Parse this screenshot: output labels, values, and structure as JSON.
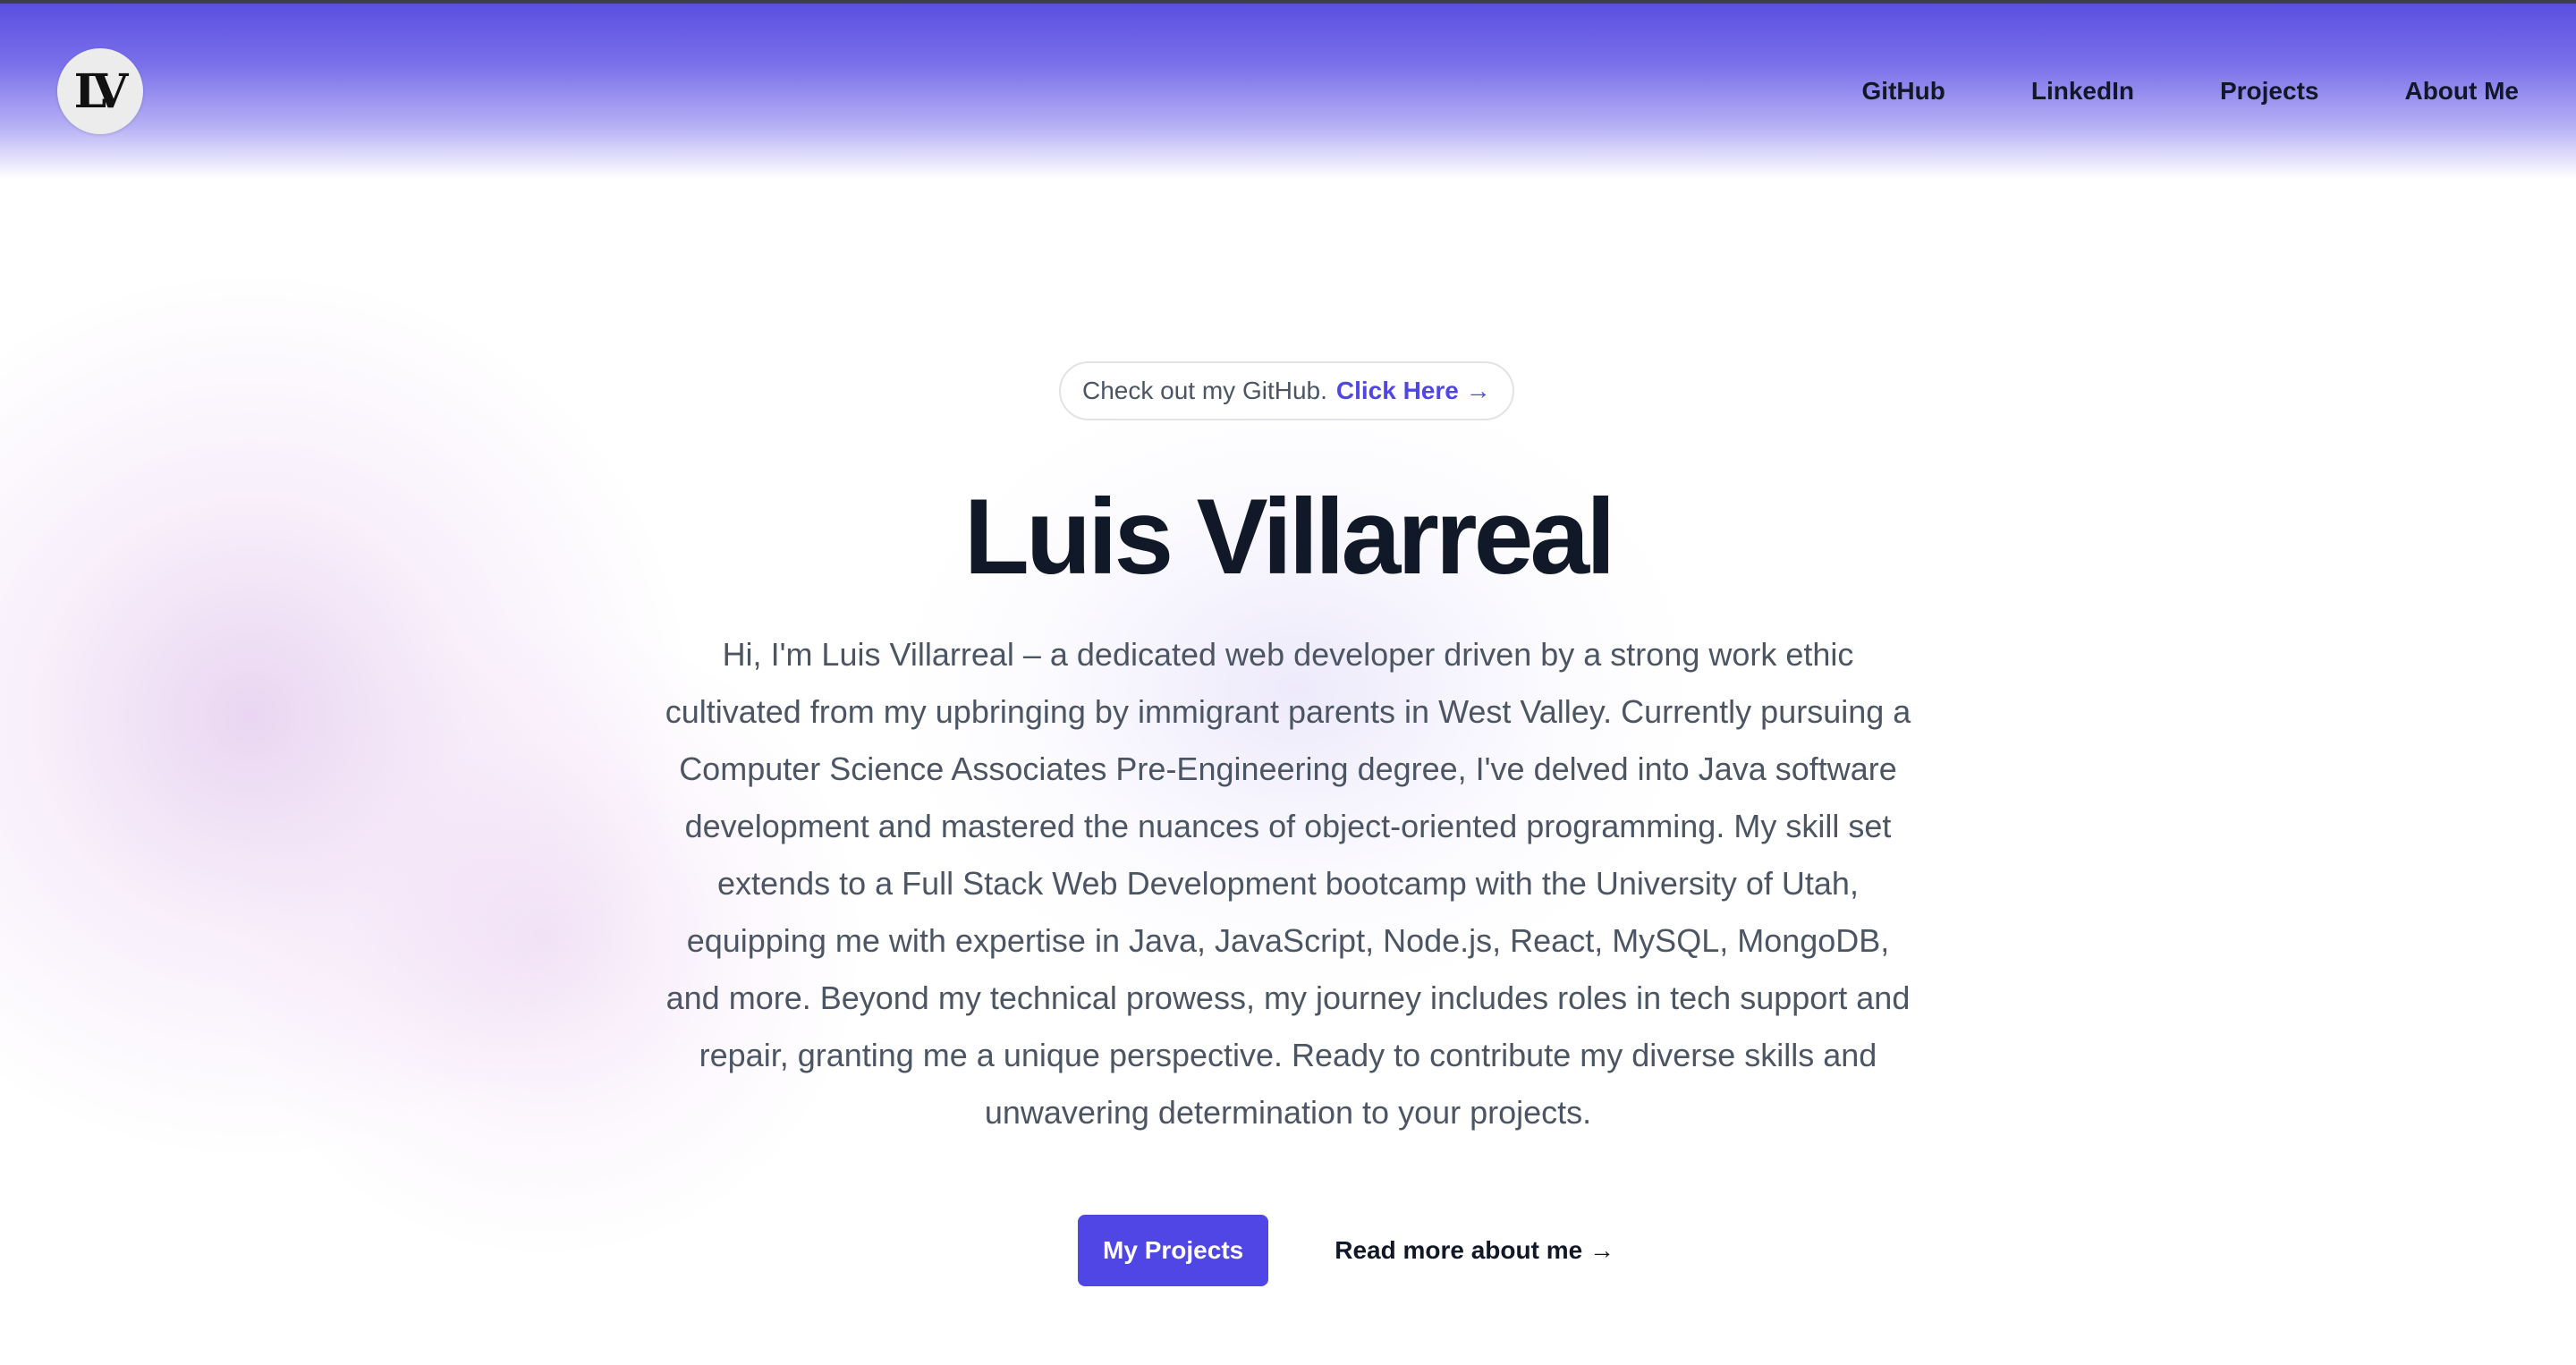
{
  "nav": {
    "logo_text": "LV",
    "links": [
      {
        "label": "GitHub"
      },
      {
        "label": "LinkedIn"
      },
      {
        "label": "Projects"
      },
      {
        "label": "About Me"
      }
    ]
  },
  "hero": {
    "pill_text": "Check out my GitHub.",
    "pill_link": "Click Here →",
    "title": "Luis Villarreal",
    "description": "Hi, I'm Luis Villarreal – a dedicated web developer driven by a strong work ethic cultivated from my upbringing by immigrant parents in West Valley. Currently pursuing a Computer Science Associates Pre-Engineering degree, I've delved into Java software development and mastered the nuances of object-oriented programming. My skill set extends to a Full Stack Web Development bootcamp with the University of Utah, equipping me with expertise in Java, JavaScript, Node.js, React, MySQL, MongoDB, and more. Beyond my technical prowess, my journey includes roles in tech support and repair, granting me a unique perspective. Ready to contribute my diverse skills and unwavering determination to your projects.",
    "primary_button": "My Projects",
    "secondary_link": "Read more about me →"
  },
  "colors": {
    "accent": "#4f46e5",
    "header_gradient_top": "#5a4fe0",
    "heading": "#111827",
    "body_text": "#4b5563"
  }
}
